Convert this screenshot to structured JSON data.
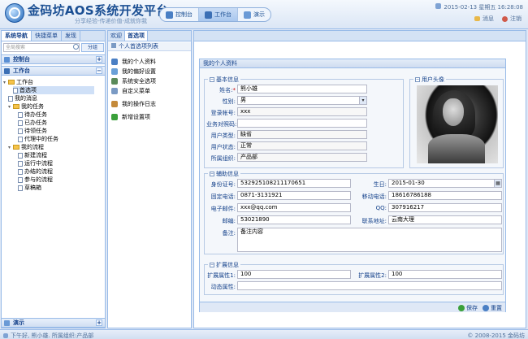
{
  "header": {
    "title": "金码坊AOS系统开发平台",
    "slogan": "分享经验-传递价值-成就你我",
    "nav": [
      {
        "label": "控制台",
        "icon": "dashboard-icon"
      },
      {
        "label": "工作台",
        "icon": "workbench-icon",
        "active": true
      },
      {
        "label": "演示",
        "icon": "demo-icon"
      }
    ],
    "datetime": "2015-02-13 星期五 16:28:08",
    "message_label": "消息",
    "logout_label": "注销"
  },
  "left": {
    "tabs": [
      "系统导航",
      "快捷菜单",
      "发现"
    ],
    "search_placeholder": "全局搜索",
    "group_button": "分组",
    "console_label": "控制台",
    "workbench_label": "工作台",
    "tree": {
      "root": "工作台",
      "items": [
        {
          "label": "首选项",
          "level": 2,
          "type": "leaf",
          "selected": true
        },
        {
          "label": "我的消息",
          "level": 2,
          "type": "leaf"
        },
        {
          "label": "我的任务",
          "level": 1,
          "type": "folder"
        },
        {
          "label": "待办任务",
          "level": 2,
          "type": "leaf"
        },
        {
          "label": "已办任务",
          "level": 2,
          "type": "leaf"
        },
        {
          "label": "待领任务",
          "level": 2,
          "type": "leaf"
        },
        {
          "label": "代理中的任务",
          "level": 2,
          "type": "leaf"
        },
        {
          "label": "我的流程",
          "level": 1,
          "type": "folder"
        },
        {
          "label": "新建流程",
          "level": 2,
          "type": "leaf"
        },
        {
          "label": "运行中流程",
          "level": 2,
          "type": "leaf"
        },
        {
          "label": "办结的流程",
          "level": 2,
          "type": "leaf"
        },
        {
          "label": "参与的流程",
          "level": 2,
          "type": "leaf"
        },
        {
          "label": "草稿箱",
          "level": 2,
          "type": "leaf"
        }
      ]
    },
    "demo_label": "演示"
  },
  "mid": {
    "tabs": [
      "欢迎",
      "首选项"
    ],
    "heading": "个人首选项列表",
    "items": [
      {
        "label": "我的个人资料",
        "color": "#4a7fc4"
      },
      {
        "label": "我的偏好设置",
        "color": "#6aa0d8"
      },
      {
        "label": "系统安全选项",
        "color": "#5a8a5a"
      },
      {
        "label": "自定义菜单",
        "color": "#7a9ac4"
      },
      {
        "label": "我的操作日志",
        "color": "#c48a3a"
      },
      {
        "label": "新增设置项",
        "color": "#3aa03a"
      }
    ]
  },
  "form": {
    "title": "我的个人资料",
    "basic": {
      "legend": "基本信息",
      "name_label": "姓名:",
      "name_req": "*",
      "name": "熊小雄",
      "gender_label": "性别:",
      "gender": "男",
      "account_label": "登录帐号:",
      "account": "xxx",
      "bizcode_label": "业务对照码:",
      "bizcode": "",
      "usertype_label": "用户类型:",
      "usertype": "缺省",
      "status_label": "用户状态:",
      "status": "正常",
      "org_label": "所属组织:",
      "org": "产品部"
    },
    "avatar_legend": "用户头像",
    "aux": {
      "legend": "辅助信息",
      "idno_label": "身份证号:",
      "idno": "532925108211170651",
      "birthday_label": "生日:",
      "birthday": "2015-01-30",
      "tel_label": "固定电话:",
      "tel": "0871-3131921",
      "mobile_label": "移动电话:",
      "mobile": "18616786188",
      "email_label": "电子邮件:",
      "email": "xxx@qq.com",
      "qq_label": "QQ:",
      "qq": "307916217",
      "zip_label": "邮编:",
      "zip": "53021890",
      "address_label": "联系地址:",
      "address": "云南大理",
      "remark_label": "备注:",
      "remark": "备注内容"
    },
    "ext": {
      "legend": "扩展信息",
      "ext1_label": "扩展属性1:",
      "ext1": "100",
      "ext2_label": "扩展属性2:",
      "ext2": "100",
      "dyn_label": "动态属性:",
      "dyn": ""
    },
    "save_label": "保存",
    "reset_label": "重置"
  },
  "footer": {
    "left": "下午好, 熊小雄. 所属组织:产品部",
    "right": "© 2008-2015 金码坊"
  }
}
